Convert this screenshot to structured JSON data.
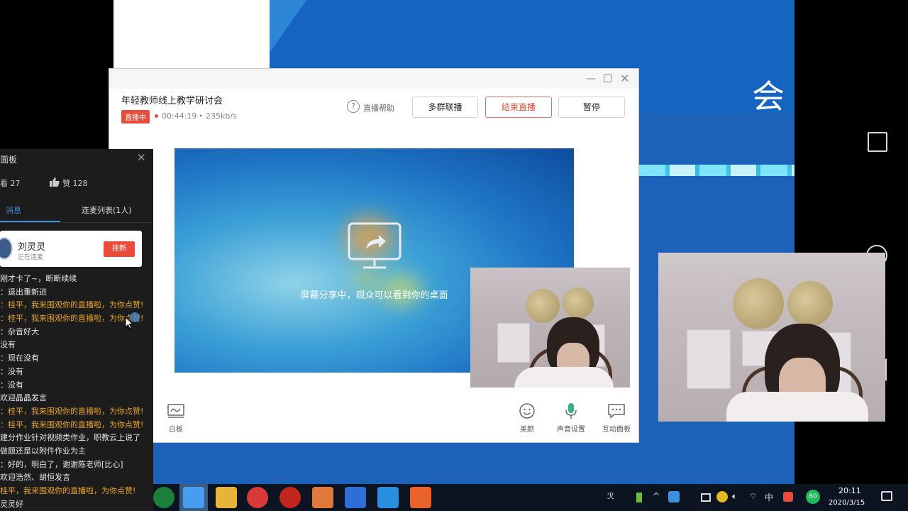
{
  "slide": {
    "title_char": "会"
  },
  "live_window": {
    "title": "年轻教师线上教学研讨会",
    "badge": "直播中",
    "duration": "00:44:19",
    "separator": "•",
    "bitrate": "235kb/s",
    "help_label": "直播帮助",
    "buttons": {
      "multi_group": "多群联播",
      "end_live": "结束直播",
      "pause": "暂停"
    },
    "share_text": "屏幕分享中，观众可以看到你的桌面",
    "tools": {
      "whiteboard": "白板",
      "beauty": "美颜",
      "sound_settings": "声音设置",
      "interactive_panel": "互动面板"
    }
  },
  "chat": {
    "title": "面板",
    "view_count": "看 27",
    "like_count": "赞 128",
    "tabs": {
      "messages": "消息",
      "mic_list": "连麦列表(1人)"
    },
    "mic_user": {
      "name": "刘灵灵",
      "status": "正在连麦",
      "hangup": "挂断"
    },
    "messages": [
      {
        "text": "刚才卡了~，断断续续",
        "gift": false
      },
      {
        "text": "：退出重新进",
        "gift": false
      },
      {
        "text": "：桂平，我来围观你的直播啦，为你点赞!",
        "gift": true
      },
      {
        "text": "：桂平，我来围观你的直播啦，为你点赞!",
        "gift": true
      },
      {
        "text": "：杂音好大",
        "gift": false
      },
      {
        "text": "没有",
        "gift": false
      },
      {
        "text": "：现在没有",
        "gift": false
      },
      {
        "text": "：没有",
        "gift": false
      },
      {
        "text": "：没有",
        "gift": false
      },
      {
        "text": "欢迎晶晶发言",
        "gift": false
      },
      {
        "text": "：桂平，我来围观你的直播啦，为你点赞!",
        "gift": true
      },
      {
        "text": "：桂平，我来围观你的直播啦，为你点赞!",
        "gift": true
      },
      {
        "text": "建分作业针对视频类作业，职教云上说了",
        "gift": false
      },
      {
        "text": "做题还是以附件作业为主",
        "gift": false
      },
      {
        "text": "：好的，明白了，谢谢陈老师[比心]",
        "gift": false
      },
      {
        "text": "欢迎浩然、胡恒发言",
        "gift": false
      },
      {
        "text": "桂平，我来围观你的直播啦，为你点赞!",
        "gift": true
      },
      {
        "text": "灵灵好",
        "gift": false
      }
    ]
  },
  "taskbar": {
    "tray_ime": "中",
    "tray_speed": "80",
    "time": "20:11",
    "date": "2020/3/15"
  }
}
